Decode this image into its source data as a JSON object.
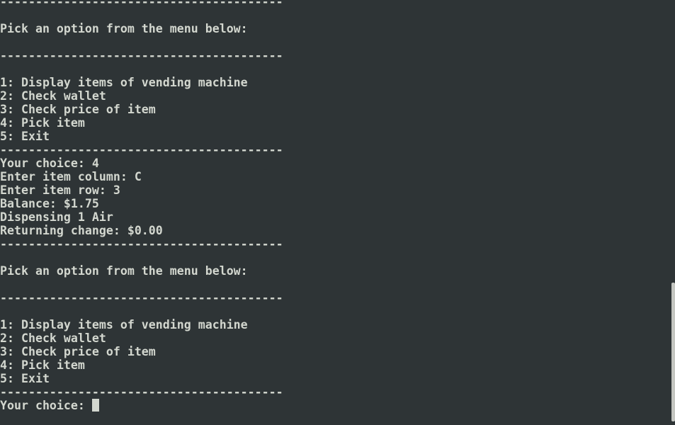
{
  "colors": {
    "background": "#2e3436",
    "text": "#d3d7cf",
    "cursor": "#d3d7cf",
    "scrollbar_thumb": "#c4c6c1",
    "scrollbar_track": "#2e3436"
  },
  "terminal": {
    "lines": [
      "----------------------------------------",
      "",
      "Pick an option from the menu below:",
      "",
      "----------------------------------------",
      "",
      "1: Display items of vending machine",
      "2: Check wallet",
      "3: Check price of item",
      "4: Pick item",
      "5: Exit",
      "----------------------------------------",
      "Your choice: 4",
      "Enter item column: C",
      "Enter item row: 3",
      "Balance: $1.75",
      "Dispensing 1 Air",
      "Returning change: $0.00",
      "----------------------------------------",
      "",
      "Pick an option from the menu below:",
      "",
      "----------------------------------------",
      "",
      "1: Display items of vending machine",
      "2: Check wallet",
      "3: Check price of item",
      "4: Pick item",
      "5: Exit",
      "----------------------------------------"
    ],
    "prompt": "Your choice: "
  }
}
